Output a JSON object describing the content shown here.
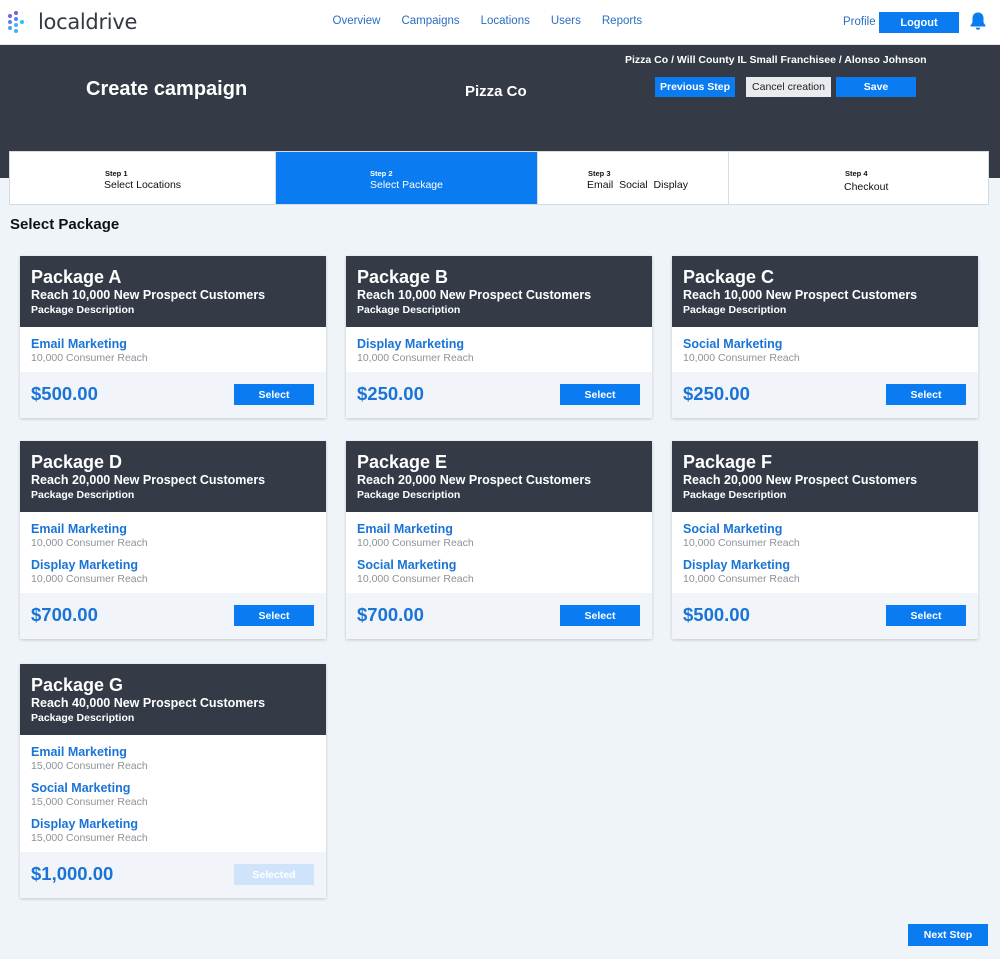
{
  "brand": {
    "name": "localdrive"
  },
  "nav": {
    "links": [
      "Overview",
      "Campaigns",
      "Locations",
      "Users",
      "Reports"
    ],
    "profile": "Profile",
    "logout": "Logout"
  },
  "header": {
    "title": "Create campaign",
    "company": "Pizza Co",
    "breadcrumb": "Pizza Co / Will County IL Small Franchisee / Alonso Johnson",
    "previous_step": "Previous Step",
    "cancel": "Cancel creation",
    "save": "Save"
  },
  "steps": [
    {
      "num": "Step 1",
      "label": "Select Locations"
    },
    {
      "num": "Step 2",
      "label": "Select Package"
    },
    {
      "num": "Step 3",
      "label": "Email  Social  Display"
    },
    {
      "num": "Step 4",
      "label": "Checkout"
    }
  ],
  "section_title": "Select Package",
  "packages": [
    {
      "name": "Package A",
      "reach": "Reach 10,000 New Prospect Customers",
      "description": "Package Description",
      "channels": [
        {
          "name": "Email Marketing",
          "reach": "10,000 Consumer Reach"
        }
      ],
      "price": "$500.00",
      "button": "Select"
    },
    {
      "name": "Package B",
      "reach": "Reach 10,000 New Prospect Customers",
      "description": "Package Description",
      "channels": [
        {
          "name": "Display Marketing",
          "reach": "10,000 Consumer Reach"
        }
      ],
      "price": "$250.00",
      "button": "Select"
    },
    {
      "name": "Package C",
      "reach": "Reach 10,000 New Prospect Customers",
      "description": "Package Description",
      "channels": [
        {
          "name": "Social Marketing",
          "reach": "10,000 Consumer Reach"
        }
      ],
      "price": "$250.00",
      "button": "Select"
    },
    {
      "name": "Package D",
      "reach": "Reach 20,000 New Prospect Customers",
      "description": "Package Description",
      "channels": [
        {
          "name": "Email Marketing",
          "reach": "10,000 Consumer Reach"
        },
        {
          "name": "Display Marketing",
          "reach": "10,000 Consumer Reach"
        }
      ],
      "price": "$700.00",
      "button": "Select"
    },
    {
      "name": "Package E",
      "reach": "Reach 20,000 New Prospect Customers",
      "description": "Package Description",
      "channels": [
        {
          "name": "Email Marketing",
          "reach": "10,000 Consumer Reach"
        },
        {
          "name": "Social Marketing",
          "reach": "10,000 Consumer Reach"
        }
      ],
      "price": "$700.00",
      "button": "Select"
    },
    {
      "name": "Package F",
      "reach": "Reach 20,000 New Prospect Customers",
      "description": "Package Description",
      "channels": [
        {
          "name": "Social Marketing",
          "reach": "10,000 Consumer Reach"
        },
        {
          "name": "Display Marketing",
          "reach": "10,000 Consumer Reach"
        }
      ],
      "price": "$500.00",
      "button": "Select"
    },
    {
      "name": "Package G",
      "reach": "Reach 40,000 New Prospect Customers",
      "description": "Package Description",
      "channels": [
        {
          "name": "Email Marketing",
          "reach": "15,000 Consumer Reach"
        },
        {
          "name": "Social Marketing",
          "reach": "15,000 Consumer Reach"
        },
        {
          "name": "Display Marketing",
          "reach": "15,000 Consumer Reach"
        }
      ],
      "price": "$1,000.00",
      "button": "Selected",
      "selected": true
    }
  ],
  "next_step": "Next Step",
  "colors": {
    "primary": "#0a7bf0",
    "header_bg": "#343b47",
    "link": "#1a74d6",
    "page_bg": "#eff4f8"
  }
}
